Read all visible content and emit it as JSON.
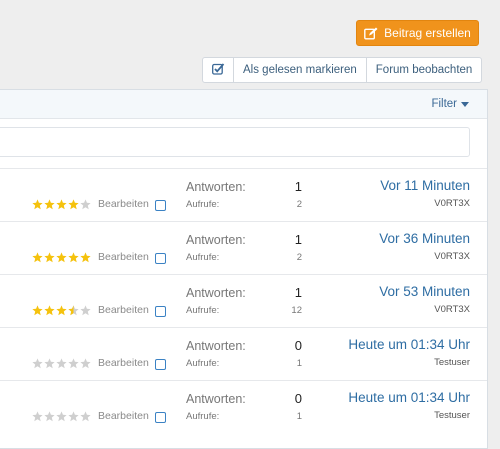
{
  "toolbar": {
    "create_label": "Beitrag erstellen",
    "mark_read_label": "Als gelesen markieren",
    "watch_label": "Forum beobachten",
    "accent": "#f0931c"
  },
  "filter": {
    "label": "Filter"
  },
  "labels": {
    "answers": "Antworten:",
    "views": "Aufrufe:",
    "edit": "Bearbeiten"
  },
  "threads": [
    {
      "rating": 4,
      "answers": "1",
      "views": "2",
      "time": "Vor 11 Minuten",
      "user": "V0RT3X"
    },
    {
      "rating": 5,
      "answers": "1",
      "views": "2",
      "time": "Vor 36 Minuten",
      "user": "V0RT3X"
    },
    {
      "rating": 3.5,
      "answers": "1",
      "views": "12",
      "time": "Vor 53 Minuten",
      "user": "V0RT3X"
    },
    {
      "rating": 0,
      "answers": "0",
      "views": "1",
      "time": "Heute um 01:34 Uhr",
      "user": "Testuser"
    },
    {
      "rating": 0,
      "answers": "0",
      "views": "1",
      "time": "Heute um 01:34 Uhr",
      "user": "Testuser"
    }
  ],
  "colors": {
    "star_on": "#f5c20d",
    "star_off": "#cfcfcf",
    "link": "#2e6da3"
  }
}
